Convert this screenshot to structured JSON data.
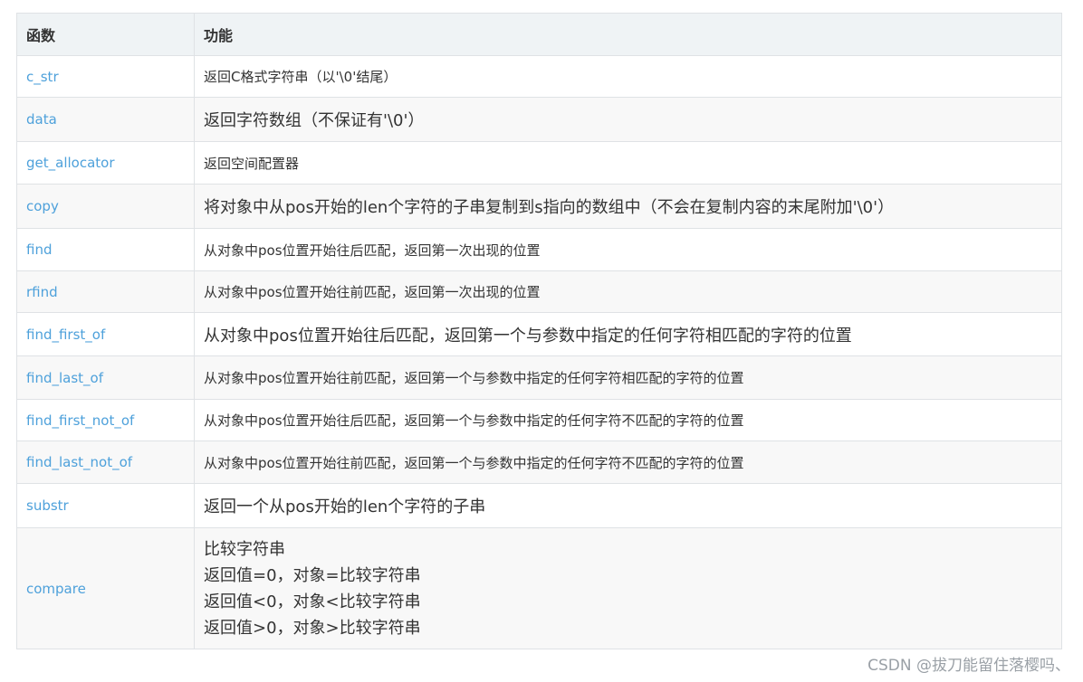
{
  "table": {
    "headers": [
      "函数",
      "功能"
    ],
    "rows": [
      {
        "name": "c_str",
        "desc": [
          "返回C格式字符串（以'\\0'结尾）"
        ]
      },
      {
        "name": "data",
        "desc": [
          "返回字符数组（不保证有'\\0'）"
        ]
      },
      {
        "name": "get_allocator",
        "desc": [
          "返回空间配置器"
        ]
      },
      {
        "name": "copy",
        "desc": [
          "将对象中从pos开始的len个字符的子串复制到s指向的数组中（不会在复制内容的末尾附加'\\0'）"
        ]
      },
      {
        "name": "find",
        "desc": [
          "从对象中pos位置开始往后匹配，返回第一次出现的位置"
        ]
      },
      {
        "name": "rfind",
        "desc": [
          "从对象中pos位置开始往前匹配，返回第一次出现的位置"
        ]
      },
      {
        "name": "find_first_of",
        "desc": [
          "从对象中pos位置开始往后匹配，返回第一个与参数中指定的任何字符相匹配的字符的位置"
        ]
      },
      {
        "name": "find_last_of",
        "desc": [
          "从对象中pos位置开始往前匹配，返回第一个与参数中指定的任何字符相匹配的字符的位置"
        ]
      },
      {
        "name": "find_first_not_of",
        "desc": [
          "从对象中pos位置开始往后匹配，返回第一个与参数中指定的任何字符不匹配的字符的位置"
        ]
      },
      {
        "name": "find_last_not_of",
        "desc": [
          "从对象中pos位置开始往前匹配，返回第一个与参数中指定的任何字符不匹配的字符的位置"
        ]
      },
      {
        "name": "substr",
        "desc": [
          "返回一个从pos开始的len个字符的子串"
        ]
      },
      {
        "name": "compare",
        "desc": [
          "比较字符串",
          "返回值=0，对象=比较字符串",
          "返回值<0，对象<比较字符串",
          "返回值>0，对象>比较字符串"
        ]
      }
    ]
  },
  "watermark": "CSDN @拔刀能留住落樱吗、"
}
